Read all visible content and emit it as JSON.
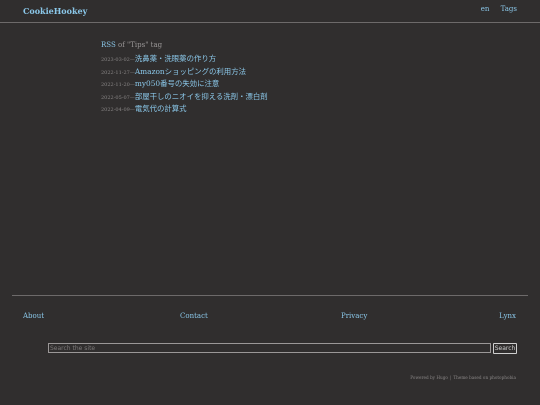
{
  "header": {
    "brand": "CookieHookey",
    "lang_link": "en",
    "tags_link": "Tags"
  },
  "main": {
    "rss_link": "RSS",
    "rss_suffix": " of \"Tips\" tag",
    "date_separator": "—",
    "posts": [
      {
        "date": "2023-03-02",
        "title": "洗鼻薬・洗眼薬の作り方"
      },
      {
        "date": "2022-11-27",
        "title": "Amazonショッピングの利用方法"
      },
      {
        "date": "2022-11-20",
        "title": "my050番号の失効に注意"
      },
      {
        "date": "2022-05-07",
        "title": "部屋干しのニオイを抑える洗剤・漂白剤"
      },
      {
        "date": "2022-04-09",
        "title": "電気代の計算式"
      }
    ]
  },
  "footer": {
    "links": {
      "about": "About",
      "contact": "Contact",
      "privacy": "Privacy",
      "lynx": "Lynx"
    },
    "search": {
      "placeholder": "Search the site",
      "button_label": "Search"
    },
    "powered_by": "Powered by Hugo",
    "theme_credit": "Theme based on photophobia"
  },
  "colors": {
    "background": "#302e2e",
    "link": "#8bc8ea",
    "text": "#9a9797",
    "rule": "#6d6a6a"
  }
}
